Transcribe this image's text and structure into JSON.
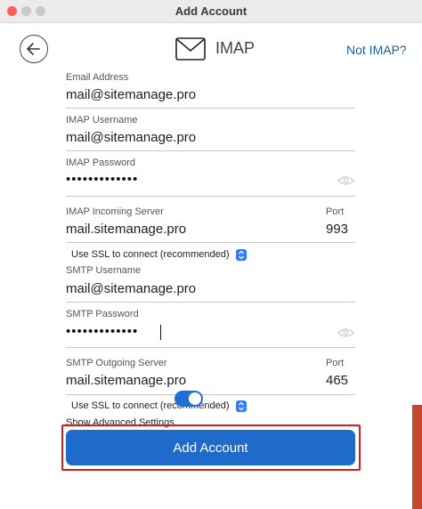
{
  "window": {
    "title": "Add Account"
  },
  "header": {
    "service": "IMAP",
    "switch_link": "Not IMAP?"
  },
  "fields": {
    "email": {
      "label": "Email Address",
      "value": "mail@sitemanage.pro"
    },
    "imap_username": {
      "label": "IMAP Username",
      "value": "mail@sitemanage.pro"
    },
    "imap_password": {
      "label": "IMAP Password",
      "value": "•••••••••••••"
    },
    "imap_server": {
      "label": "IMAP Incoming Server",
      "value": "mail.sitemanage.pro"
    },
    "imap_port": {
      "label": "Port",
      "value": "993"
    },
    "imap_ssl": {
      "selected": "Use SSL to connect (recommended)"
    },
    "smtp_username": {
      "label": "SMTP Username",
      "value": "mail@sitemanage.pro"
    },
    "smtp_password": {
      "label": "SMTP Password",
      "value": "•••••••••••••"
    },
    "smtp_server": {
      "label": "SMTP Outgoing Server",
      "value": "mail.sitemanage.pro"
    },
    "smtp_port": {
      "label": "Port",
      "value": "465"
    },
    "smtp_ssl": {
      "selected": "Use SSL to connect (recommended)"
    }
  },
  "advanced": {
    "label": "Show Advanced Settings",
    "enabled": true
  },
  "actions": {
    "submit_label": "Add Account"
  },
  "colors": {
    "accent": "#1f6bcc",
    "highlight": "#d41f1f",
    "link": "#1d5fa0"
  }
}
